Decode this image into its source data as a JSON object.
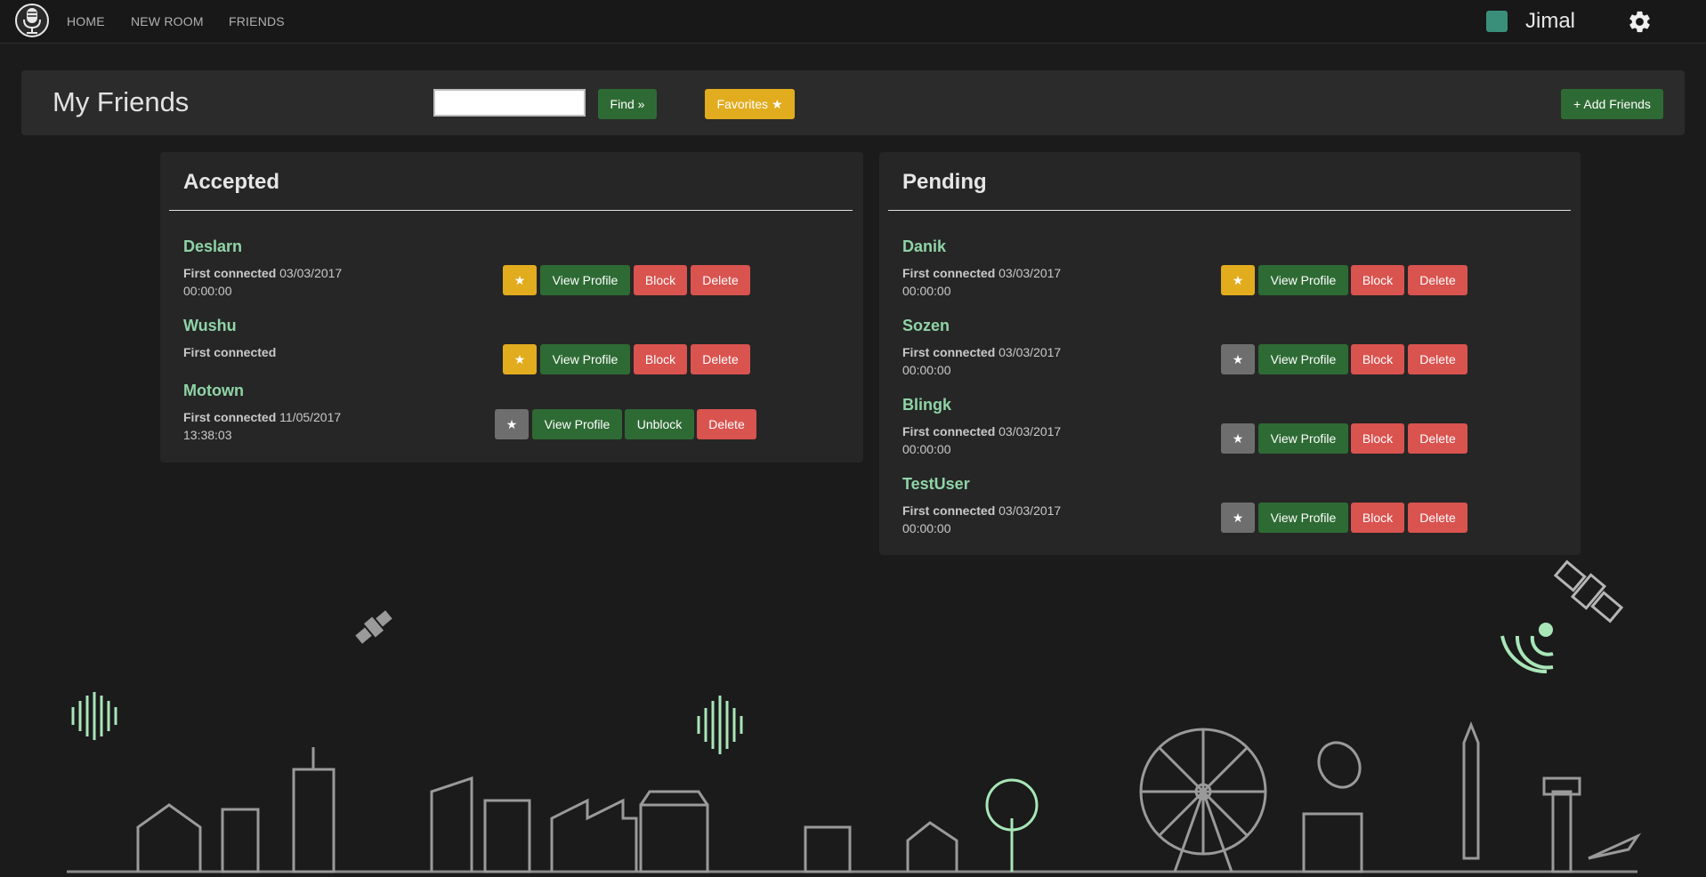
{
  "nav": {
    "links": [
      "HOME",
      "NEW ROOM",
      "FRIENDS"
    ],
    "username": "Jimal",
    "status_color": "#3a8f7a"
  },
  "header": {
    "title": "My Friends",
    "search_value": "",
    "find_label": "Find »",
    "favorites_label": "Favorites ★",
    "add_friends_label": "+ Add Friends"
  },
  "accepted": {
    "title": "Accepted",
    "friends": [
      {
        "name": "Deslarn",
        "connected_label": "First connected",
        "date": "03/03/2017",
        "time": "00:00:00",
        "favorite": true,
        "blocked": false
      },
      {
        "name": "Wushu",
        "connected_label": "First connected",
        "date": "",
        "time": "",
        "favorite": true,
        "blocked": false
      },
      {
        "name": "Motown",
        "connected_label": "First connected",
        "date": "11/05/2017",
        "time": "13:38:03",
        "favorite": false,
        "blocked": true
      }
    ]
  },
  "pending": {
    "title": "Pending",
    "friends": [
      {
        "name": "Danik",
        "connected_label": "First connected",
        "date": "03/03/2017",
        "time": "00:00:00",
        "favorite": true,
        "blocked": false
      },
      {
        "name": "Sozen",
        "connected_label": "First connected",
        "date": "03/03/2017",
        "time": "00:00:00",
        "favorite": false,
        "blocked": false
      },
      {
        "name": "Blingk",
        "connected_label": "First connected",
        "date": "03/03/2017",
        "time": "00:00:00",
        "favorite": false,
        "blocked": false
      },
      {
        "name": "TestUser",
        "connected_label": "First connected",
        "date": "03/03/2017",
        "time": "00:00:00",
        "favorite": false,
        "blocked": false
      }
    ]
  },
  "buttons": {
    "star": "★",
    "view_profile": "View Profile",
    "block": "Block",
    "unblock": "Unblock",
    "delete": "Delete"
  },
  "colors": {
    "green": "#2e6b34",
    "yellow": "#e2ac1f",
    "red": "#d9534f",
    "gray": "#6e6e6e",
    "name": "#8fd4a6"
  },
  "icons": {
    "logo": "microphone-logo-icon",
    "settings": "gear-icon"
  }
}
